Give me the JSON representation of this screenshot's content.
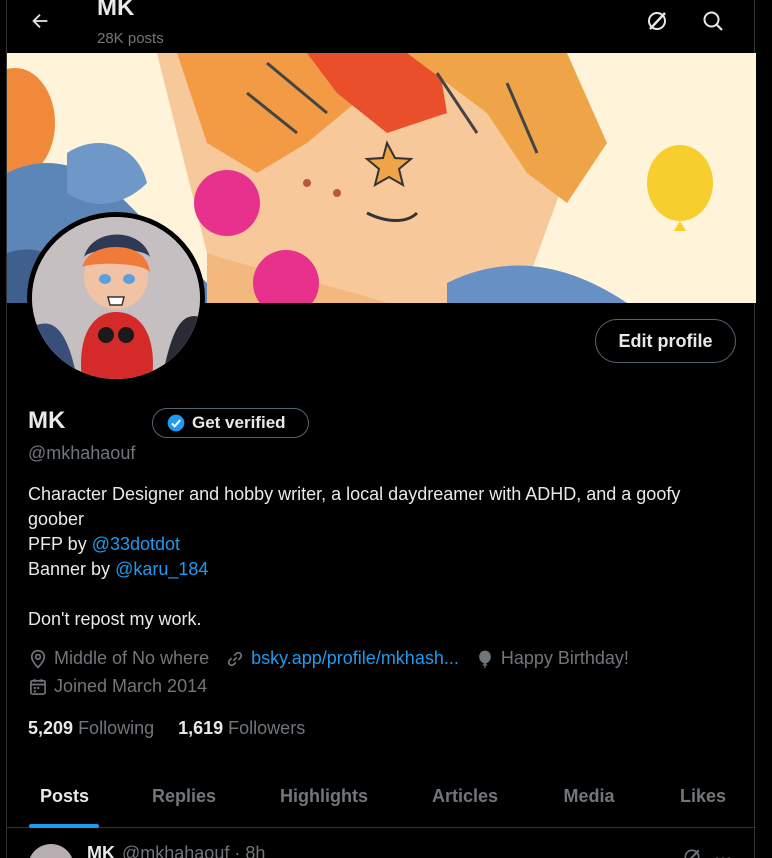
{
  "header": {
    "name": "MK",
    "post_count": "28K posts",
    "back_icon": "arrow-left-icon",
    "grok_icon": "grok-icon",
    "search_icon": "search-icon"
  },
  "profile": {
    "edit_label": "Edit profile",
    "name": "MK",
    "verify_label": "Get verified",
    "handle": "@mkhahaouf",
    "bio": {
      "line1": "Character Designer and hobby writer, a local daydreamer with ADHD, and a goofy goober",
      "pfp_prefix": "PFP by ",
      "pfp_link": "@33dotdot",
      "banner_prefix": "Banner by ",
      "banner_link": "@karu_184",
      "line5": "Don't repost my work."
    },
    "location": "Middle of No where",
    "website": "bsky.app/profile/mkhash...",
    "birthday": "Happy Birthday!",
    "joined": "Joined March 2014",
    "following_count": "5,209",
    "following_label": "Following",
    "followers_count": "1,619",
    "followers_label": "Followers"
  },
  "tabs": [
    "Posts",
    "Replies",
    "Highlights",
    "Articles",
    "Media",
    "Likes"
  ],
  "active_tab": "Posts",
  "post_peek": {
    "name": "MK",
    "handle_time": "@mkhahaouf · 8h"
  },
  "colors": {
    "accent": "#1d9bf0",
    "background": "#000000",
    "text": "#e7e9ea",
    "muted": "#71767b",
    "border": "#2f3336"
  }
}
